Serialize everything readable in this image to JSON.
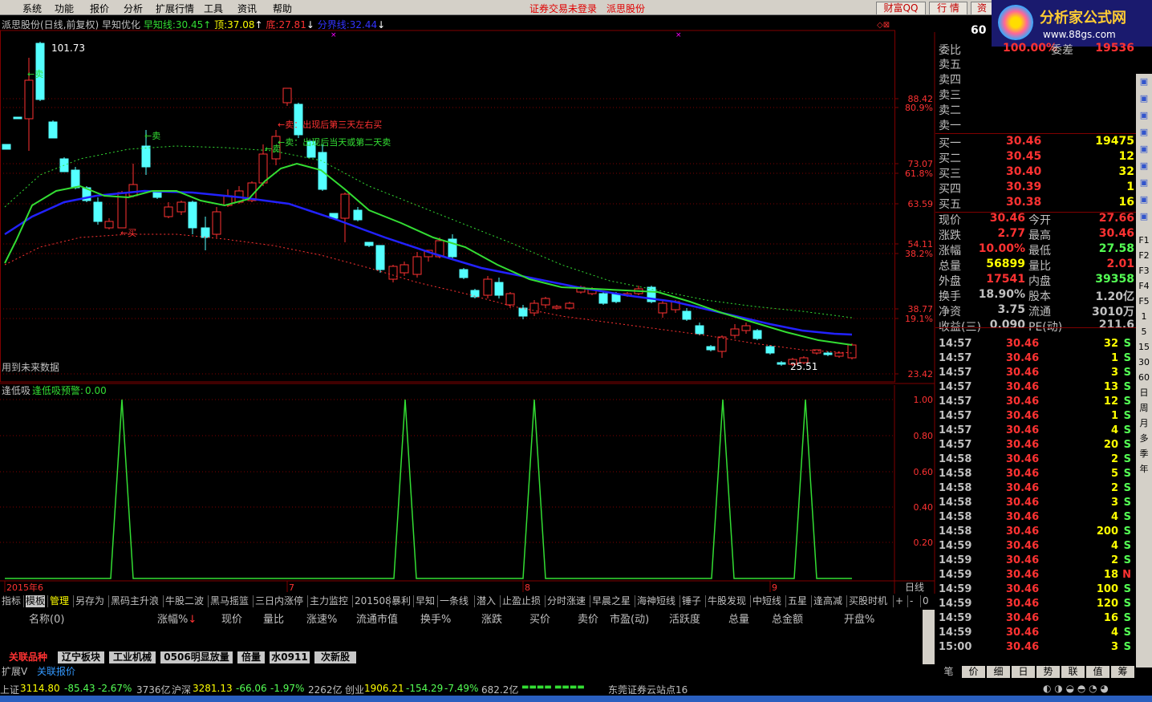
{
  "menu": [
    "系统",
    "功能",
    "报价",
    "分析",
    "扩展行情",
    "工具",
    "资讯",
    "帮助"
  ],
  "status_msg": "证券交易未登录",
  "stock_title": "派思股份",
  "top_buttons": [
    "财富QQ",
    "行 情",
    "资"
  ],
  "logo": {
    "title": "分析家公式网",
    "url_text": "www.88gs.com"
  },
  "chart": {
    "heading": "派思股份(日线,前复权) 早知优化",
    "ind1_label": "早知线:",
    "ind1_value": "30.45",
    "ind2_label": "顶:",
    "ind2_value": "37.08",
    "ind3_label": "底:",
    "ind3_value": "27.81",
    "ind4_label": "分界线:",
    "ind4_value": "32.44",
    "price_axis": [
      "88.42",
      "80.9%",
      "73.07",
      "61.8%",
      "63.59",
      "54.11",
      "38.2%",
      "38.77",
      "19.1%",
      "23.42"
    ],
    "high_label": "101.73",
    "low_label": "25.51",
    "future_note": "用到未来数据",
    "annot_sell1": "←卖：出现后第三天左右买",
    "annot_sell2": "←卖：出现后当天或第二天卖",
    "sell_label": "←卖",
    "buy_label": "←买",
    "sub_heading": "逢低吸",
    "sub_label": "逢低吸预警:",
    "sub_value": "0.00",
    "sub_axis": [
      "1.00",
      "0.80",
      "0.60",
      "0.40",
      "0.20"
    ],
    "dates": [
      "2015年6",
      "7",
      "8",
      "9"
    ],
    "period": "日线"
  },
  "chart_data": {
    "type": "candlestick",
    "title": "派思股份(日线,前复权) 早知优化",
    "y_axis_labels": [
      "88.42",
      "73.07",
      "63.59",
      "54.11",
      "38.77",
      "23.42"
    ],
    "fib_labels": [
      "80.9%",
      "61.8%",
      "38.2%",
      "19.1%"
    ],
    "x_labels": [
      "2015年6",
      "7",
      "8",
      "9"
    ],
    "indicators": {
      "早知线": 30.45,
      "顶": 37.08,
      "底": 27.81,
      "分界线": 32.44
    },
    "high": 101.73,
    "low": 25.51,
    "sub_indicator": {
      "name": "逢低吸",
      "value": 0.0,
      "ylim": [
        0,
        1.0
      ],
      "spikes_at_candle_index": [
        11,
        38,
        50,
        68,
        76
      ]
    }
  },
  "quote": {
    "code": "60",
    "weibi_label": "委比",
    "weibi_value": "100.00%",
    "weicha_label": "委差",
    "weicha_value": "19536",
    "sell_levels": [
      "卖五",
      "卖四",
      "卖三",
      "卖二",
      "卖一"
    ],
    "buy_levels": [
      {
        "label": "买一",
        "price": "30.46",
        "vol": "19475"
      },
      {
        "label": "买二",
        "price": "30.45",
        "vol": "12"
      },
      {
        "label": "买三",
        "price": "30.40",
        "vol": "32"
      },
      {
        "label": "买四",
        "price": "30.39",
        "vol": "1"
      },
      {
        "label": "买五",
        "price": "30.38",
        "vol": "16"
      }
    ],
    "stats": [
      {
        "l1": "现价",
        "v1": "30.46",
        "l2": "今开",
        "v2": "27.66"
      },
      {
        "l1": "涨跌",
        "v1": "2.77",
        "l2": "最高",
        "v2": "30.46"
      },
      {
        "l1": "涨幅",
        "v1": "10.00%",
        "l2": "最低",
        "v2": "27.58"
      },
      {
        "l1": "总量",
        "v1": "56899",
        "l2": "量比",
        "v2": "2.01"
      },
      {
        "l1": "外盘",
        "v1": "17541",
        "l2": "内盘",
        "v2": "39358"
      },
      {
        "l1": "换手",
        "v1": "18.90%",
        "l2": "股本",
        "v2": "1.20亿"
      },
      {
        "l1": "净资",
        "v1": "3.75",
        "l2": "流通",
        "v2": "3010万"
      },
      {
        "l1": "收益(三)",
        "v1": "0.090",
        "l2": "PE(动)",
        "v2": "211.6"
      }
    ],
    "ticks": [
      {
        "t": "14:57",
        "p": "30.46",
        "v": "32",
        "s": "S"
      },
      {
        "t": "14:57",
        "p": "30.46",
        "v": "1",
        "s": "S"
      },
      {
        "t": "14:57",
        "p": "30.46",
        "v": "3",
        "s": "S"
      },
      {
        "t": "14:57",
        "p": "30.46",
        "v": "13",
        "s": "S"
      },
      {
        "t": "14:57",
        "p": "30.46",
        "v": "12",
        "s": "S"
      },
      {
        "t": "14:57",
        "p": "30.46",
        "v": "1",
        "s": "S"
      },
      {
        "t": "14:57",
        "p": "30.46",
        "v": "4",
        "s": "S"
      },
      {
        "t": "14:57",
        "p": "30.46",
        "v": "20",
        "s": "S"
      },
      {
        "t": "14:58",
        "p": "30.46",
        "v": "2",
        "s": "S"
      },
      {
        "t": "14:58",
        "p": "30.46",
        "v": "5",
        "s": "S"
      },
      {
        "t": "14:58",
        "p": "30.46",
        "v": "2",
        "s": "S"
      },
      {
        "t": "14:58",
        "p": "30.46",
        "v": "3",
        "s": "S"
      },
      {
        "t": "14:58",
        "p": "30.46",
        "v": "4",
        "s": "S"
      },
      {
        "t": "14:58",
        "p": "30.46",
        "v": "200",
        "s": "S"
      },
      {
        "t": "14:59",
        "p": "30.46",
        "v": "4",
        "s": "S"
      },
      {
        "t": "14:59",
        "p": "30.46",
        "v": "2",
        "s": "S"
      },
      {
        "t": "14:59",
        "p": "30.46",
        "v": "18",
        "s": "N"
      },
      {
        "t": "14:59",
        "p": "30.46",
        "v": "100",
        "s": "S"
      },
      {
        "t": "14:59",
        "p": "30.46",
        "v": "120",
        "s": "S"
      },
      {
        "t": "14:59",
        "p": "30.46",
        "v": "16",
        "s": "S"
      },
      {
        "t": "14:59",
        "p": "30.46",
        "v": "4",
        "s": "S"
      },
      {
        "t": "15:00",
        "p": "30.46",
        "v": "3",
        "s": "S"
      }
    ],
    "bottom_tabs": [
      "笔",
      "价",
      "细",
      "日",
      "势",
      "联",
      "值",
      "筹"
    ]
  },
  "side_buttons": [
    "F1",
    "F2",
    "F3",
    "F4",
    "F5",
    "1",
    "5",
    "15",
    "30",
    "60",
    "日",
    "周",
    "月",
    "多",
    "季",
    "年"
  ],
  "indicator_tabs": [
    "指标",
    "模板",
    "管理",
    "另存为",
    "黑码主升浪",
    "牛股二波",
    "黑马摇篮",
    "三日内涨停",
    "主力监控",
    "201508",
    "暴利",
    "早知",
    "一条线",
    "潜入",
    "止盈止损",
    "分时涨速",
    "早晨之星",
    "海神短线",
    "锤子",
    "牛股发现",
    "中短线",
    "五星",
    "逢高减",
    "买股时机",
    "+",
    "-",
    "0"
  ],
  "table_headers": [
    "名称(0)",
    "涨幅%",
    "现价",
    "量比",
    "涨速%",
    "流通市值",
    "换手%",
    "涨跌",
    "买价",
    "卖价",
    "市盈(动)",
    "活跃度",
    "总量",
    "总金额",
    "开盘%"
  ],
  "board_tabs": [
    "关联品种",
    "辽宁板块",
    "工业机械",
    "0506明显放量",
    "倍量",
    "水0911",
    "次新股"
  ],
  "ext_tabs": [
    "扩展V",
    "关联报价"
  ],
  "statusbar": {
    "sh_label": "上证",
    "sh_val": "3114.80",
    "sh_chg": "-85.43",
    "sh_pct": "-2.67%",
    "sh_amt": "3736亿",
    "hs_label": "沪深",
    "hs_val": "3281.13",
    "hs_chg": "-66.06",
    "hs_pct": "-1.97%",
    "hs_amt": "2262亿",
    "cy_label": "创业",
    "cy_val": "1906.21",
    "cy_chg": "-154.29",
    "cy_pct": "-7.49%",
    "cy_amt": "682.2亿",
    "server": "东莞证券云站点16"
  },
  "colors": {
    "up": "#ff3232",
    "down": "#54ffff",
    "green_line": "#33dd33",
    "blue_line": "#2222ff",
    "grid": "#800000",
    "bg": "#000000"
  }
}
